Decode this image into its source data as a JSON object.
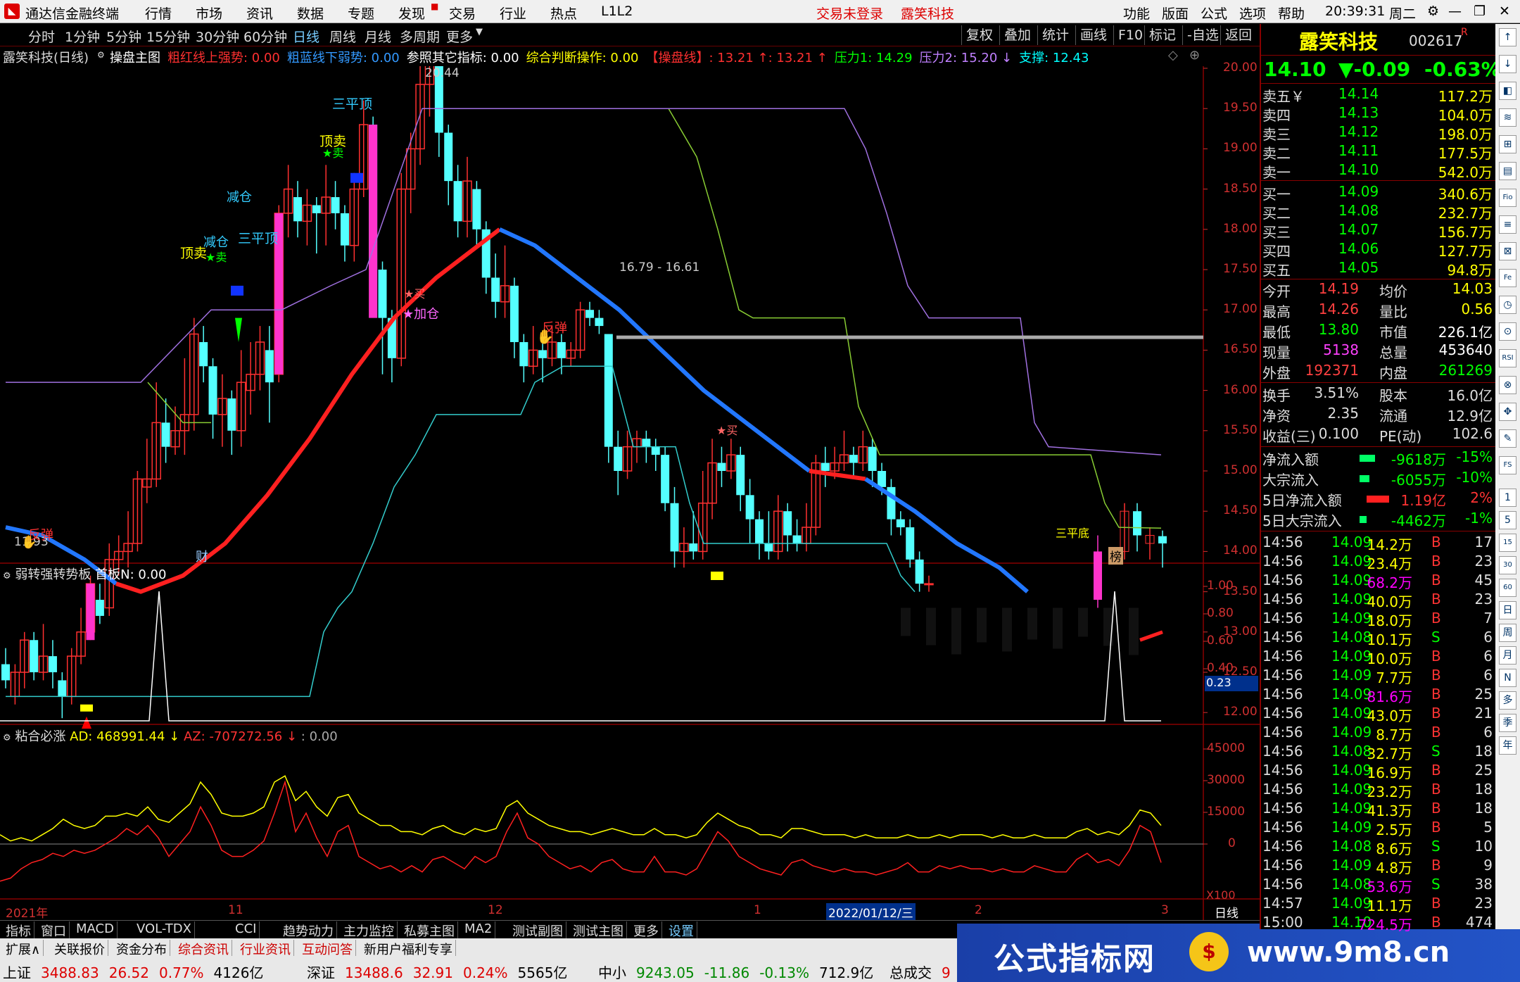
{
  "menubar": {
    "app_title": "通达信金融终端",
    "menus": [
      "行情",
      "市场",
      "资讯",
      "数据",
      "专题",
      "发现",
      "交易",
      "行业",
      "热点",
      "L1L2"
    ],
    "center_status": "交易未登录",
    "center_stock": "露笑科技",
    "right_menus": [
      "功能",
      "版面",
      "公式",
      "选项",
      "帮助"
    ],
    "clock": "20:39:31",
    "weekday": "周二"
  },
  "toolbar": {
    "periods": [
      "分时",
      "1分钟",
      "5分钟",
      "15分钟",
      "30分钟",
      "60分钟",
      "日线",
      "周线",
      "月线",
      "多周期",
      "更多"
    ],
    "active": "日线",
    "buttons": [
      "复权",
      "叠加",
      "统计",
      "画线",
      "F10",
      "标记",
      "-自选",
      "返回"
    ]
  },
  "infoline": {
    "stock": "露笑科技(日线)",
    "formula": "操盘主图",
    "items": [
      {
        "text": "粗红线上强势: 0.00",
        "color": "#ff3030"
      },
      {
        "text": "粗蓝线下弱势: 0.00",
        "color": "#3399ff"
      },
      {
        "text": "参照其它指标: 0.00",
        "color": "#ffffff"
      },
      {
        "text": "综合判断操作: 0.00",
        "color": "#ffff00"
      },
      {
        "text": "【操盘线】: 13.21 ↑: 13.21 ↑",
        "color": "#ff3030"
      },
      {
        "text": "压力1: 14.29",
        "color": "#00ff00"
      },
      {
        "text": "压力2: 15.20 ↓",
        "color": "#c080ff"
      },
      {
        "text": "支撑: 12.43",
        "color": "#00ffff"
      }
    ]
  },
  "main_chart": {
    "y_ticks": [
      "20.00",
      "19.50",
      "19.00",
      "18.50",
      "18.00",
      "17.50",
      "17.00",
      "16.50",
      "16.00",
      "15.50",
      "15.00",
      "14.50",
      "14.00",
      "13.50",
      "13.00",
      "12.50",
      "12.00"
    ],
    "labels": {
      "high": "20.44",
      "low": "11.93",
      "range_line": "16.79 - 16.61",
      "sanpingding1": "三平顶",
      "sanpingding2": "三平顶",
      "dingmai1": "顶卖",
      "dingmai2": "顶卖",
      "jiancang1": "减仓",
      "jiancang2": "减仓",
      "mai1": "★卖",
      "mai2": "★卖",
      "buy1": "★买",
      "buy2": "★买",
      "jiacang": "★加仓",
      "fantan1": "反弹",
      "fantan2": "反弹",
      "sanpingdi": "三平底",
      "cai": "财",
      "bang": "榜"
    }
  },
  "sub1": {
    "title": "弱转强转势板",
    "value": "首板N: 0.00",
    "y_ticks": [
      "1.00",
      "0.80",
      "0.60",
      "0.40"
    ],
    "cursor": "0.23"
  },
  "sub2": {
    "title": "粘合必涨",
    "ad": "AD: 468991.44 ↓",
    "az": "AZ: -707272.56 ↓",
    "zero": ": 0.00",
    "y_ticks": [
      "45000",
      "30000",
      "15000",
      "0"
    ],
    "scale": "X100"
  },
  "xaxis": {
    "labels": [
      "2021年",
      "11",
      "12",
      "1",
      "2",
      "3"
    ],
    "date_box": "2022/01/12/三",
    "period": "日线"
  },
  "bottom_tabs": [
    "指标",
    "窗口",
    "MACD",
    "VOL-TDX",
    "CCI",
    "趋势动力",
    "主力监控",
    "私募主图",
    "MA2",
    "测试副图",
    "测试主图",
    "更多",
    "设置"
  ],
  "bottom_tabs2": [
    "扩展∧",
    "关联报价",
    "资金分布",
    "综合资讯",
    "行业资讯",
    "互动问答",
    "新用户福利专享"
  ],
  "index_bar": [
    {
      "name": "上证",
      "value": "3488.83",
      "chg": "26.52",
      "pct": "0.77%",
      "amt": "4126亿"
    },
    {
      "name": "深证",
      "value": "13488.6",
      "chg": "32.91",
      "pct": "0.24%",
      "amt": "5565亿"
    },
    {
      "name": "中小",
      "value": "9243.05",
      "chg": "-11.86",
      "pct": "-0.13%",
      "amt": "712.9亿"
    },
    {
      "name": "总成交",
      "value": "9",
      "chg": "",
      "pct": "",
      "amt": ""
    }
  ],
  "watermark": {
    "text": "公式指标网",
    "url": "www.9m8.cn"
  },
  "quote": {
    "name": "露笑科技",
    "code": "002617",
    "flag": "R",
    "price": "14.10",
    "change": "▼-0.09",
    "pct": "-0.63%",
    "asks": [
      {
        "label": "卖五￥",
        "price": "14.14",
        "vol": "117.2万"
      },
      {
        "label": "卖四",
        "price": "14.13",
        "vol": "104.0万"
      },
      {
        "label": "卖三",
        "price": "14.12",
        "vol": "198.0万"
      },
      {
        "label": "卖二",
        "price": "14.11",
        "vol": "177.5万"
      },
      {
        "label": "卖一",
        "price": "14.10",
        "vol": "542.0万"
      }
    ],
    "bids": [
      {
        "label": "买一",
        "price": "14.09",
        "vol": "340.6万"
      },
      {
        "label": "买二",
        "price": "14.08",
        "vol": "232.7万"
      },
      {
        "label": "买三",
        "price": "14.07",
        "vol": "156.7万"
      },
      {
        "label": "买四",
        "price": "14.06",
        "vol": "127.7万"
      },
      {
        "label": "买五",
        "price": "14.05",
        "vol": "94.8万"
      }
    ],
    "stats": [
      {
        "l1": "今开",
        "v1": "14.19",
        "c1": "#ff4040",
        "l2": "均价",
        "v2": "14.03",
        "c2": "#ffff00"
      },
      {
        "l1": "最高",
        "v1": "14.26",
        "c1": "#ff4040",
        "l2": "量比",
        "v2": "0.56",
        "c2": "#ffff00"
      },
      {
        "l1": "最低",
        "v1": "13.80",
        "c1": "#00ff00",
        "l2": "市值",
        "v2": "226.1亿",
        "c2": "#ffffff"
      },
      {
        "l1": "现量",
        "v1": "5138",
        "c1": "#ff40ff",
        "l2": "总量",
        "v2": "453640",
        "c2": "#ffffff"
      },
      {
        "l1": "外盘",
        "v1": "192371",
        "c1": "#ff4040",
        "l2": "内盘",
        "v2": "261269",
        "c2": "#00ff00"
      }
    ],
    "fin": [
      {
        "l1": "换手",
        "v1": "3.51%",
        "l2": "股本",
        "v2": "16.0亿"
      },
      {
        "l1": "净资",
        "v1": "2.35",
        "l2": "流通",
        "v2": "12.9亿"
      },
      {
        "l1": "收益(三)",
        "v1": "0.100",
        "l2": "PE(动)",
        "v2": "102.6"
      }
    ],
    "flows": [
      {
        "label": "净流入额",
        "val": "-9618万",
        "pct": "-15%",
        "bar": "#00ff66",
        "w": 22
      },
      {
        "label": "大宗流入",
        "val": "-6055万",
        "pct": "-10%",
        "bar": "#00ff66",
        "w": 14
      },
      {
        "label": "5日净流入额",
        "val": "1.19亿",
        "pct": "2%",
        "bar": "#ff2020",
        "w": 32
      },
      {
        "label": "5日大宗流入",
        "val": "-4462万",
        "pct": "-1%",
        "bar": "#00ff66",
        "w": 10
      }
    ],
    "ticks": [
      {
        "t": "14:56",
        "p": "14.09",
        "v": "14.2万",
        "bs": "B",
        "n": "17"
      },
      {
        "t": "14:56",
        "p": "14.09",
        "v": "23.4万",
        "bs": "B",
        "n": "23"
      },
      {
        "t": "14:56",
        "p": "14.09",
        "v": "68.2万",
        "bs": "B",
        "n": "45"
      },
      {
        "t": "14:56",
        "p": "14.09",
        "v": "40.0万",
        "bs": "B",
        "n": "23"
      },
      {
        "t": "14:56",
        "p": "14.09",
        "v": "18.0万",
        "bs": "B",
        "n": "7"
      },
      {
        "t": "14:56",
        "p": "14.08",
        "v": "10.1万",
        "bs": "S",
        "n": "6"
      },
      {
        "t": "14:56",
        "p": "14.09",
        "v": "10.0万",
        "bs": "B",
        "n": "6"
      },
      {
        "t": "14:56",
        "p": "14.09",
        "v": "7.7万",
        "bs": "B",
        "n": "6"
      },
      {
        "t": "14:56",
        "p": "14.09",
        "v": "81.6万",
        "bs": "B",
        "n": "25"
      },
      {
        "t": "14:56",
        "p": "14.09",
        "v": "43.0万",
        "bs": "B",
        "n": "21"
      },
      {
        "t": "14:56",
        "p": "14.09",
        "v": "8.7万",
        "bs": "B",
        "n": "6"
      },
      {
        "t": "14:56",
        "p": "14.08",
        "v": "32.7万",
        "bs": "S",
        "n": "18"
      },
      {
        "t": "14:56",
        "p": "14.09",
        "v": "16.9万",
        "bs": "B",
        "n": "25"
      },
      {
        "t": "14:56",
        "p": "14.09",
        "v": "23.2万",
        "bs": "B",
        "n": "18"
      },
      {
        "t": "14:56",
        "p": "14.09",
        "v": "41.3万",
        "bs": "B",
        "n": "18"
      },
      {
        "t": "14:56",
        "p": "14.09",
        "v": "2.5万",
        "bs": "B",
        "n": "5"
      },
      {
        "t": "14:56",
        "p": "14.08",
        "v": "8.6万",
        "bs": "S",
        "n": "10"
      },
      {
        "t": "14:56",
        "p": "14.09",
        "v": "4.8万",
        "bs": "B",
        "n": "9"
      },
      {
        "t": "14:56",
        "p": "14.08",
        "v": "53.6万",
        "bs": "S",
        "n": "38"
      },
      {
        "t": "14:57",
        "p": "14.09",
        "v": "11.1万",
        "bs": "B",
        "n": "23"
      },
      {
        "t": "15:00",
        "p": "14.10",
        "v": "724.5万",
        "bs": "B",
        "n": "474"
      }
    ]
  },
  "right_icons": [
    "↑",
    "↓",
    "◧",
    "≋",
    "⊞",
    "▤",
    "Fio",
    "≡",
    "⊠",
    "Fe",
    "◷",
    "⊙",
    "RSI",
    "⊗",
    "✥",
    "✎",
    "FS",
    "1",
    "5",
    "15",
    "30",
    "60",
    "日",
    "周",
    "月",
    "N",
    "多",
    "季",
    "年"
  ]
}
